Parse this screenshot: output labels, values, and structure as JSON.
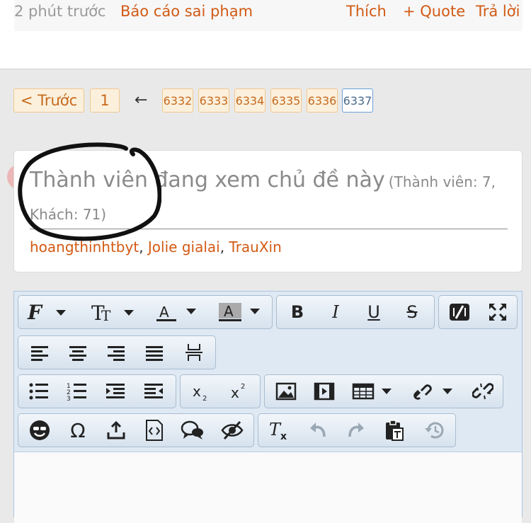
{
  "post_meta": {
    "time": "2 phút trước",
    "report": "Báo cáo sai phạm",
    "like": "Thích",
    "quote": "+ Quote",
    "reply": "Trả lời"
  },
  "pagination": {
    "prev": "< Trước",
    "first": "1",
    "arrow": "←",
    "pages": [
      "6332",
      "6333",
      "6334",
      "6335",
      "6336",
      "6337"
    ],
    "current": "6337"
  },
  "viewers": {
    "title": "Thành viên đang xem chủ đề này",
    "counts": "(Thành viên: 7, Khách: 71)",
    "users": [
      "hoangthinhtbyt",
      "Jolie gialai",
      "TrauXin"
    ],
    "separator": ", "
  },
  "editor": {
    "toolbar_icons": [
      "font-family-icon",
      "font-size-icon",
      "text-color-icon",
      "background-color-icon",
      "bold-icon",
      "italic-icon",
      "underline-icon",
      "strikethrough-icon",
      "toggle-source-icon",
      "maximize-icon",
      "align-left-icon",
      "align-center-icon",
      "align-right-icon",
      "justify-icon",
      "horizontal-rule-icon",
      "bullet-list-icon",
      "numbered-list-icon",
      "indent-icon",
      "outdent-icon",
      "subscript-icon",
      "superscript-icon",
      "image-icon",
      "media-icon",
      "table-icon",
      "link-icon",
      "unlink-icon",
      "smilies-icon",
      "special-char-icon",
      "upload-icon",
      "code-icon",
      "quote-icon",
      "hide-icon",
      "remove-format-icon",
      "undo-icon",
      "redo-icon",
      "paste-icon",
      "restore-draft-icon"
    ]
  },
  "colors": {
    "link": "#d25a14",
    "page_bg": "#e9e9e9",
    "pager_bg": "#fbf0dc",
    "editor_border": "#a9c6e0"
  }
}
